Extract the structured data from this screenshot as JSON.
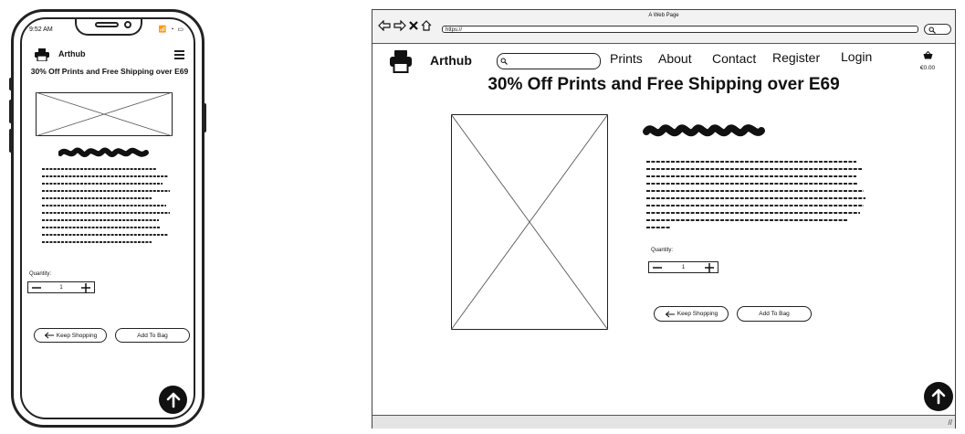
{
  "mobile": {
    "status_time": "9:52 AM",
    "status_icons": "📶 ◔ ▭",
    "brand": "Arthub",
    "promo": "30% Off Prints and Free Shipping over E69",
    "quantity_label": "Quantity:",
    "quantity_value": "1",
    "keep_shopping": "Keep Shopping",
    "add_to_bag": "Add To Bag"
  },
  "browser": {
    "window_title": "A Web Page",
    "url": "https://"
  },
  "desktop": {
    "brand": "Arthub",
    "nav": {
      "prints": "Prints",
      "about": "About",
      "contact": "Contact",
      "register": "Register",
      "login": "Login"
    },
    "bag_total": "€0.00",
    "promo": "30% Off Prints and Free Shipping over E69",
    "quantity_label": "Quantity:",
    "quantity_value": "1",
    "keep_shopping": "Keep Shopping",
    "add_to_bag": "Add To Bag"
  },
  "icons": [
    "printer-icon",
    "hamburger-icon",
    "arrow-up-icon",
    "search-icon",
    "shopping-basket-icon",
    "back-icon",
    "forward-icon",
    "close-icon",
    "home-icon",
    "minus-icon",
    "plus-icon",
    "arrow-left-icon"
  ]
}
